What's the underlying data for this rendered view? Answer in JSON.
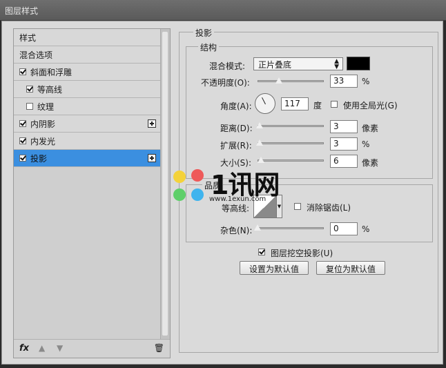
{
  "window": {
    "title": "图层样式"
  },
  "left_panel": {
    "items": [
      {
        "label": "样式",
        "checkbox": false,
        "checked": false,
        "indent": false,
        "plus": false,
        "selected": false
      },
      {
        "label": "混合选项",
        "checkbox": false,
        "checked": false,
        "indent": false,
        "plus": false,
        "selected": false
      },
      {
        "label": "斜面和浮雕",
        "checkbox": true,
        "checked": true,
        "indent": false,
        "plus": false,
        "selected": false
      },
      {
        "label": "等高线",
        "checkbox": true,
        "checked": true,
        "indent": true,
        "plus": false,
        "selected": false
      },
      {
        "label": "纹理",
        "checkbox": true,
        "checked": false,
        "indent": true,
        "plus": false,
        "selected": false
      },
      {
        "label": "内阴影",
        "checkbox": true,
        "checked": true,
        "indent": false,
        "plus": true,
        "selected": false
      },
      {
        "label": "内发光",
        "checkbox": true,
        "checked": true,
        "indent": false,
        "plus": false,
        "selected": false
      },
      {
        "label": "投影",
        "checkbox": true,
        "checked": true,
        "indent": false,
        "plus": true,
        "selected": true
      }
    ],
    "footer": {
      "fx": "fx",
      "up_icon": "arrow-up-icon",
      "down_icon": "arrow-down-icon",
      "trash_icon": "trash-icon"
    }
  },
  "drop_shadow": {
    "section_title": "投影",
    "structure": {
      "title": "结构",
      "blend_mode_label": "混合模式:",
      "blend_mode_value": "正片叠底",
      "blend_color": "#000000",
      "opacity_label": "不透明度(O):",
      "opacity_value": "33",
      "opacity_unit": "%",
      "opacity_level": 0.33,
      "angle_label": "角度(A):",
      "angle_value": "117",
      "angle_unit": "度",
      "global_light_label": "使用全局光(G)",
      "global_light_checked": false,
      "distance_label": "距离(D):",
      "distance_value": "3",
      "distance_unit": "像素",
      "spread_label": "扩展(R):",
      "spread_value": "3",
      "spread_unit": "%",
      "size_label": "大小(S):",
      "size_value": "6",
      "size_unit": "像素"
    },
    "quality": {
      "title": "品质",
      "contour_label": "等高线:",
      "anti_alias_label": "消除锯齿(L)",
      "anti_alias_checked": false,
      "noise_label": "杂色(N):",
      "noise_value": "0",
      "noise_unit": "%"
    },
    "knockout_label": "图层挖空投影(U)",
    "knockout_checked": true,
    "set_default_button": "设置为默认值",
    "reset_default_button": "复位为默认值"
  },
  "watermark": {
    "text": "1讯网",
    "url": "www.1exun.com"
  },
  "colors": {
    "selection": "#3b8fe0",
    "panel": "#dadada"
  }
}
